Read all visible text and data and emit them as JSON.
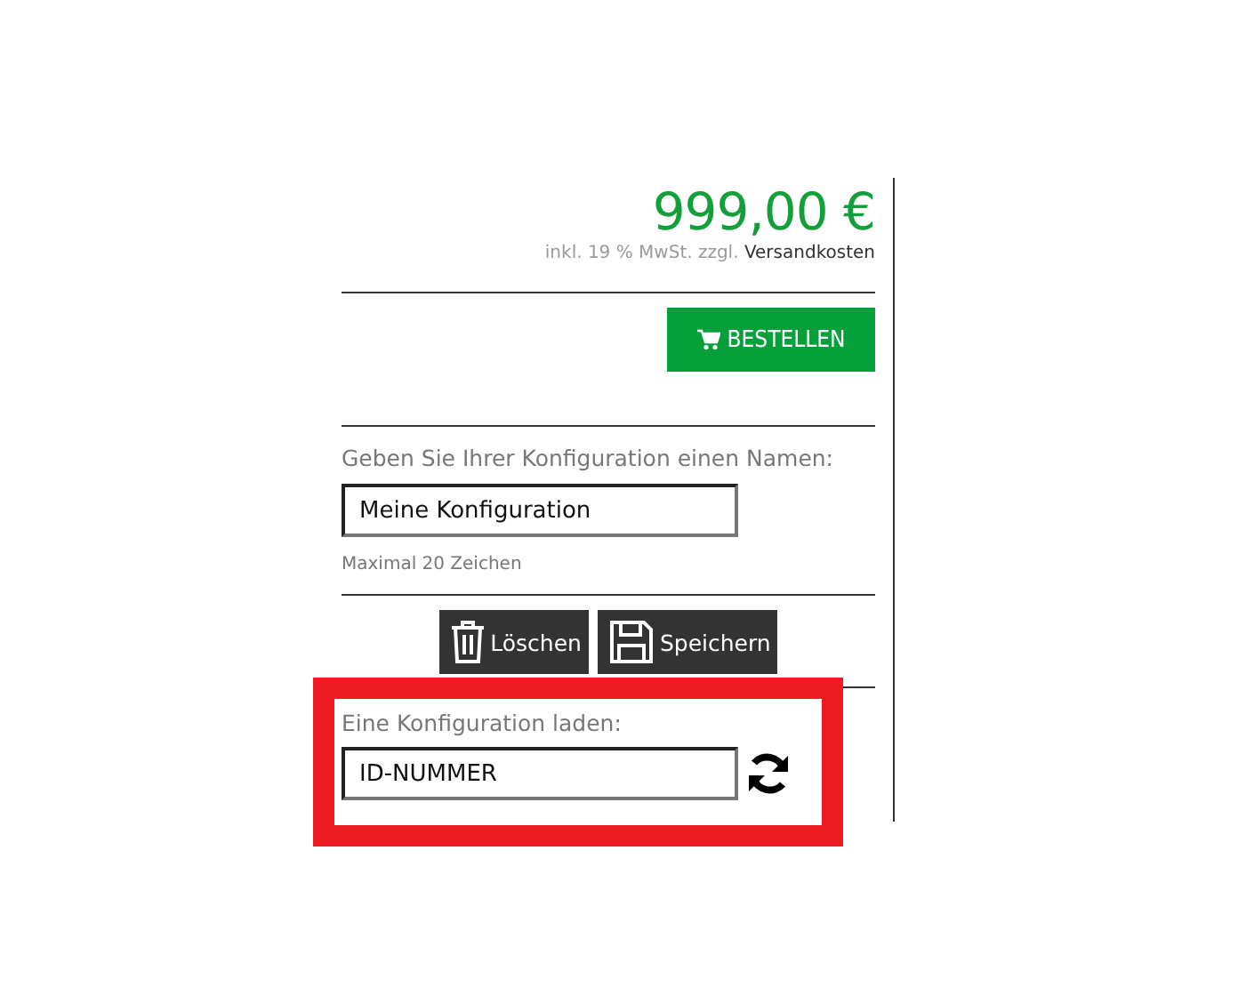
{
  "price": {
    "amount": "999,00 €",
    "tax_note": "inkl. 19 % MwSt. zzgl.",
    "shipping_link": "Versandkosten"
  },
  "order_button": {
    "label": "BESTELLEN"
  },
  "name_config": {
    "label": "Geben Sie Ihrer Konfiguration einen Namen:",
    "value": "Meine Konfiguration",
    "hint": "Maximal 20 Zeichen"
  },
  "actions": [
    {
      "kind": "delete",
      "label": "Löschen"
    },
    {
      "kind": "save",
      "label": "Speichern"
    }
  ],
  "load_config": {
    "label": "Eine Konfiguration laden:",
    "value": "ID-NUMMER",
    "highlighted": true
  }
}
